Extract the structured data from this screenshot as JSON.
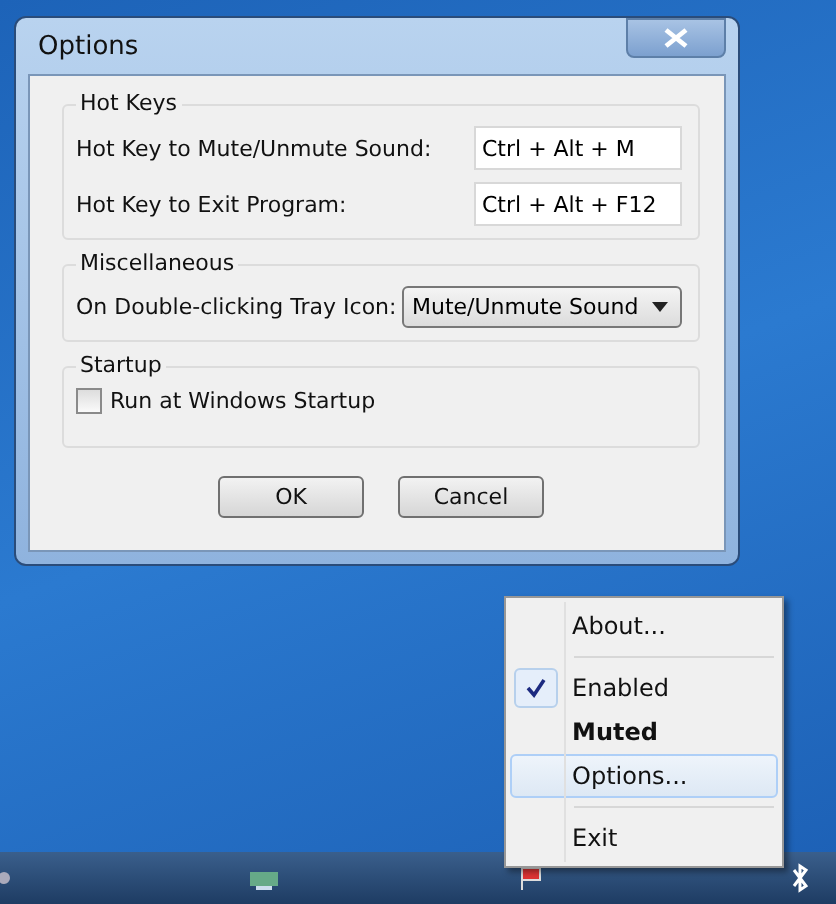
{
  "window": {
    "title": "Options"
  },
  "groups": [
    {
      "title": "Hot Keys",
      "rows": [
        {
          "kind": "field",
          "label": "Hot Key to Mute/Unmute Sound:",
          "value": "Ctrl + Alt + M"
        },
        {
          "kind": "field",
          "label": "Hot Key to Exit Program:",
          "value": "Ctrl + Alt + F12"
        }
      ]
    },
    {
      "title": "Miscellaneous",
      "rows": [
        {
          "kind": "dropdown",
          "label": "On Double-clicking Tray Icon:",
          "value": "Mute/Unmute Sound"
        }
      ]
    },
    {
      "title": "Startup",
      "rows": [
        {
          "kind": "checkbox",
          "label": "Run at Windows Startup",
          "checked": false
        }
      ]
    }
  ],
  "buttons": [
    "OK",
    "Cancel"
  ],
  "tray_menu": [
    {
      "kind": "item",
      "label": "About...",
      "checked": false,
      "bold": false,
      "selected": false
    },
    {
      "kind": "separator"
    },
    {
      "kind": "item",
      "label": "Enabled",
      "checked": true,
      "bold": false,
      "selected": false
    },
    {
      "kind": "item",
      "label": "Muted",
      "checked": false,
      "bold": true,
      "selected": false
    },
    {
      "kind": "item",
      "label": "Options...",
      "checked": false,
      "bold": false,
      "selected": true
    },
    {
      "kind": "separator"
    },
    {
      "kind": "item",
      "label": "Exit",
      "checked": false,
      "bold": false,
      "selected": false
    }
  ]
}
